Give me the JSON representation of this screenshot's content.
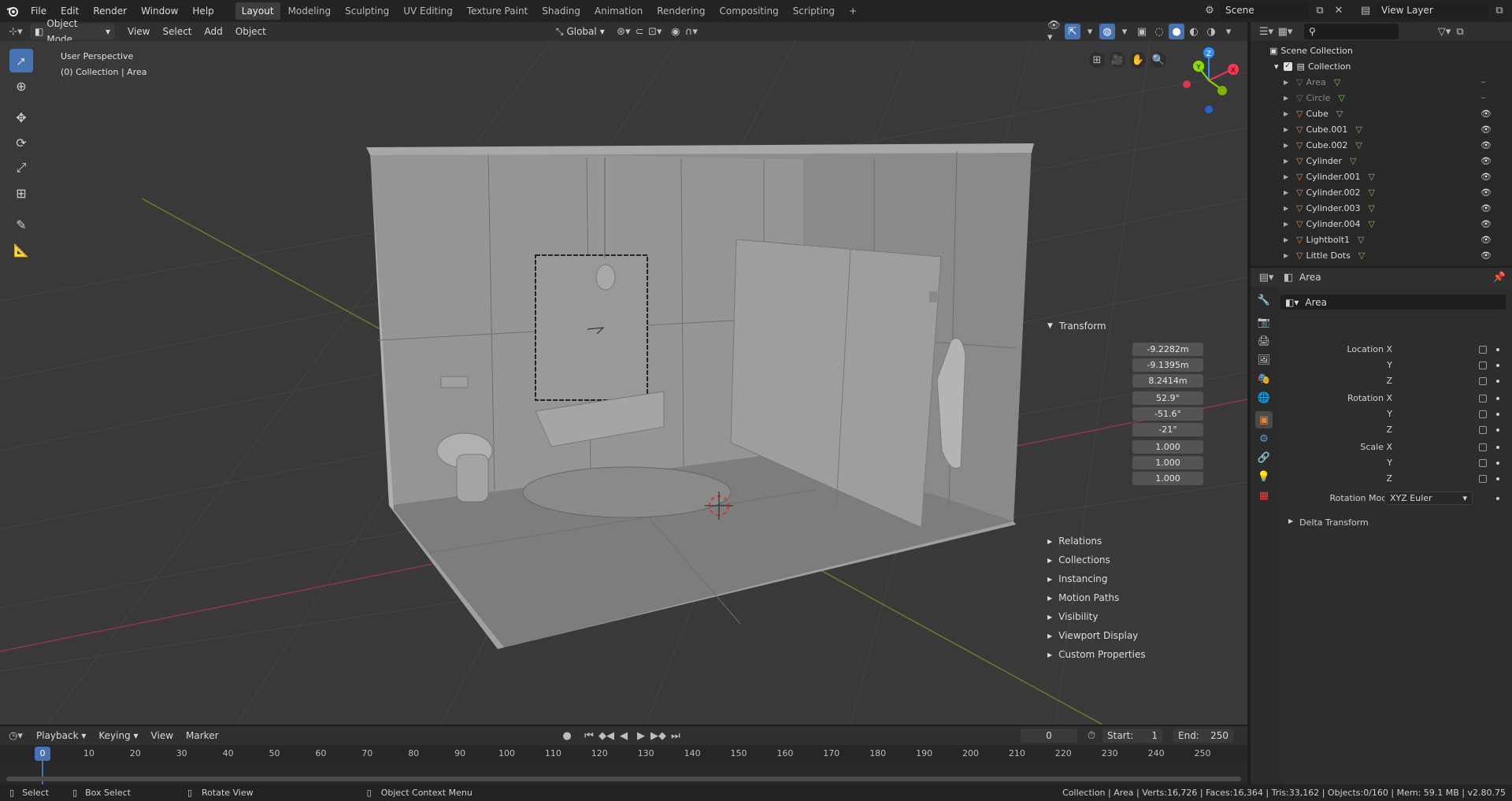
{
  "app": {
    "logo": "blender-logo"
  },
  "menubar": [
    "File",
    "Edit",
    "Render",
    "Window",
    "Help"
  ],
  "workspaces": [
    {
      "label": "Layout",
      "active": true
    },
    {
      "label": "Modeling"
    },
    {
      "label": "Sculpting"
    },
    {
      "label": "UV Editing"
    },
    {
      "label": "Texture Paint"
    },
    {
      "label": "Shading"
    },
    {
      "label": "Animation"
    },
    {
      "label": "Rendering"
    },
    {
      "label": "Compositing"
    },
    {
      "label": "Scripting"
    },
    {
      "label": "+"
    }
  ],
  "scene": {
    "name": "Scene",
    "view_layer": "View Layer"
  },
  "viewport_header": {
    "mode": "Object Mode",
    "menus": [
      "View",
      "Select",
      "Add",
      "Object"
    ],
    "orientation": "Global"
  },
  "viewport": {
    "view_name": "User Perspective",
    "collection_info": "(0) Collection | Area",
    "gizmo": {
      "x": "X",
      "y": "Y",
      "z": "Z"
    }
  },
  "tools": [
    "select-box",
    "cursor",
    "move",
    "rotate",
    "scale",
    "transform",
    "annotate",
    "measure"
  ],
  "outliner": {
    "search_placeholder": "",
    "root": "Scene Collection",
    "collection": "Collection",
    "items": [
      {
        "name": "Area",
        "dim": true
      },
      {
        "name": "Circle",
        "dim": true
      },
      {
        "name": "Cube"
      },
      {
        "name": "Cube.001"
      },
      {
        "name": "Cube.002"
      },
      {
        "name": "Cylinder"
      },
      {
        "name": "Cylinder.001"
      },
      {
        "name": "Cylinder.002"
      },
      {
        "name": "Cylinder.003"
      },
      {
        "name": "Cylinder.004"
      },
      {
        "name": "Lightbolt1"
      },
      {
        "name": "Little Dots"
      }
    ]
  },
  "properties": {
    "header_object": "Area",
    "object_name": "Area",
    "transform_title": "Transform",
    "location": {
      "label": "Location X",
      "x": "-9.2282m",
      "y": "-9.1395m",
      "z": "8.2414m"
    },
    "rotation": {
      "label": "Rotation X",
      "x": "52.9°",
      "y": "-51.6°",
      "z": "-21°"
    },
    "scale": {
      "label": "Scale X",
      "x": "1.000",
      "y": "1.000",
      "z": "1.000"
    },
    "axis_y": "Y",
    "axis_z": "Z",
    "rotation_mode_label": "Rotation Mode",
    "rotation_mode": "XYZ Euler",
    "delta": "Delta Transform",
    "panels": [
      "Relations",
      "Collections",
      "Instancing",
      "Motion Paths",
      "Visibility",
      "Viewport Display",
      "Custom Properties"
    ]
  },
  "timeline": {
    "menus": [
      "Playback",
      "Keying",
      "View",
      "Marker"
    ],
    "current_frame": "0",
    "start_label": "Start:",
    "start": "1",
    "end_label": "End:",
    "end": "250",
    "ruler": [
      "0",
      "10",
      "20",
      "30",
      "40",
      "50",
      "60",
      "70",
      "80",
      "90",
      "100",
      "110",
      "120",
      "130",
      "140",
      "150",
      "160",
      "170",
      "180",
      "190",
      "200",
      "210",
      "220",
      "230",
      "240",
      "250"
    ]
  },
  "statusbar": {
    "select": "Select",
    "box_select": "Box Select",
    "rotate_view": "Rotate View",
    "context_menu": "Object Context Menu",
    "info": "Collection | Area | Verts:16,726 | Faces:16,364 | Tris:33,162 | Objects:0/160 | Mem: 59.1 MB | v2.80.75"
  },
  "colors": {
    "accent": "#4772b3",
    "x_axis": "#ff3352",
    "y_axis": "#8bdc00",
    "z_axis": "#2890ff",
    "object_orange": "#e0853a"
  }
}
